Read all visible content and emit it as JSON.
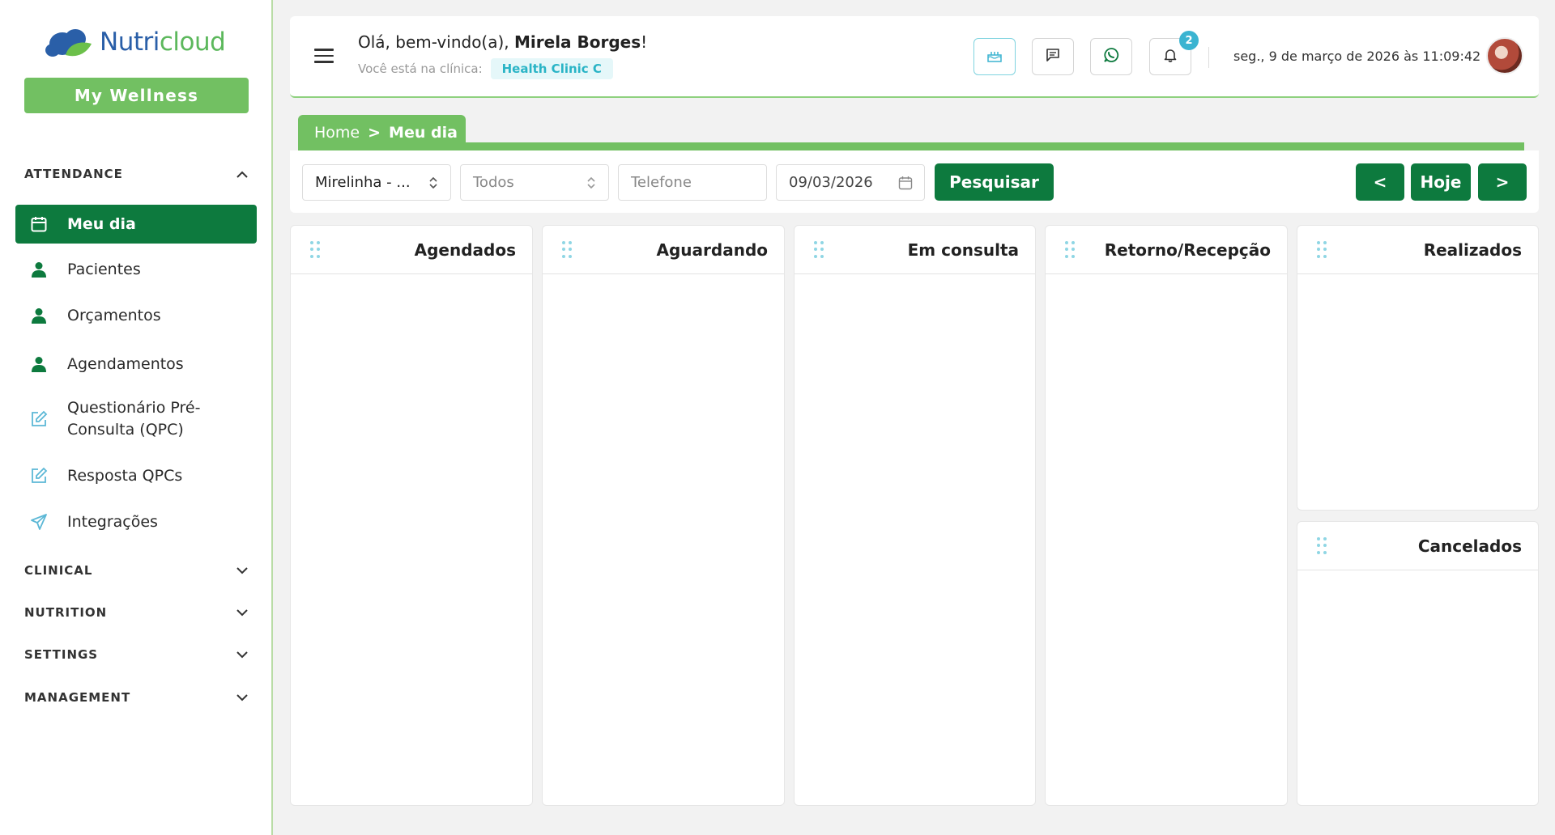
{
  "app": {
    "logo_text_a": "Nutri",
    "logo_text_b": "cloud",
    "wellness_label": "My Wellness",
    "colors": {
      "primary": "#0d7a3e",
      "accent": "#72c062",
      "teal": "#2ab4c6",
      "brand_blue": "#2a5fa8"
    }
  },
  "sidebar": {
    "sections": {
      "attendance": "ATTENDANCE",
      "clinical": "CLINICAL",
      "nutrition": "NUTRITION",
      "settings": "SETTINGS",
      "management": "MANAGEMENT"
    },
    "items": [
      {
        "label": "Meu dia",
        "icon": "calendar-icon"
      },
      {
        "label": "Pacientes",
        "icon": "user-icon"
      },
      {
        "label": "Orçamentos",
        "icon": "user-icon"
      },
      {
        "label": "Agendamentos",
        "icon": "user-icon"
      },
      {
        "label": "Questionário Pré-",
        "label2": "Consulta (QPC)",
        "icon": "edit-icon"
      },
      {
        "label": "Resposta QPCs",
        "icon": "edit-icon"
      },
      {
        "label": "Integrações",
        "icon": "send-icon"
      }
    ]
  },
  "header": {
    "greeting_prefix": "Olá, bem-vindo(a), ",
    "user_name": "Mirela Borges",
    "greeting_suffix": "!",
    "clinic_label": "Você está na clínica:",
    "clinic_name": "Health Clinic C",
    "notification_count": "2",
    "datetime": "seg., 9 de março de 2026 às 11:09:42"
  },
  "breadcrumb": {
    "home": "Home",
    "separator": ">",
    "current": "Meu dia"
  },
  "filters": {
    "professional": "Mirelinha - ...",
    "status": "Todos",
    "phone_placeholder": "Telefone",
    "date": "09/03/2026",
    "search_label": "Pesquisar",
    "prev_label": "<",
    "today_label": "Hoje",
    "next_label": ">"
  },
  "board": {
    "columns": [
      "Agendados",
      "Aguardando",
      "Em consulta",
      "Retorno/Recepção",
      "Realizados",
      "Cancelados"
    ]
  }
}
